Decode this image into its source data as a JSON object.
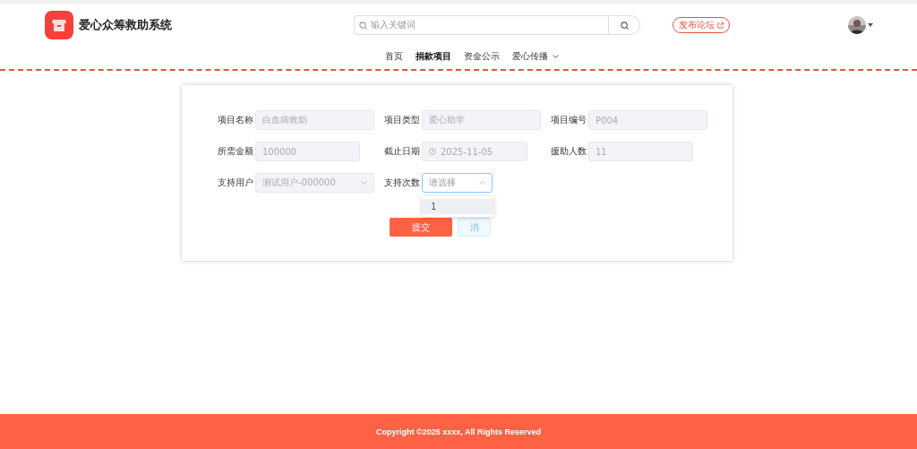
{
  "header": {
    "title": "爱心众筹救助系统",
    "search": {
      "placeholder": "输入关键词"
    },
    "publish_button": "发布论坛"
  },
  "nav": [
    {
      "label": "首页",
      "selected": false,
      "dropdown": false
    },
    {
      "label": "捐款项目",
      "selected": true,
      "dropdown": false
    },
    {
      "label": "资金公示",
      "selected": false,
      "dropdown": false
    },
    {
      "label": "爱心传播",
      "selected": false,
      "dropdown": true
    }
  ],
  "form": {
    "rows": [
      [
        {
          "label": "项目名称",
          "kind": "text",
          "value": "白血病救助",
          "disabled": true
        },
        {
          "label": "项目类型",
          "kind": "text",
          "value": "爱心助学",
          "disabled": true
        },
        {
          "label": "项目编号",
          "kind": "text",
          "value": "P004",
          "disabled": true
        }
      ],
      [
        {
          "label": "所需金额",
          "kind": "text",
          "value": "100000",
          "disabled": true
        },
        {
          "label": "截止日期",
          "kind": "date",
          "value": "2025-11-05",
          "disabled": true
        },
        {
          "label": "援助人数",
          "kind": "text",
          "value": "11",
          "disabled": true
        }
      ],
      [
        {
          "label": "支持用户",
          "kind": "select",
          "value": "测试用户-000000",
          "disabled": true,
          "expanded": false
        },
        {
          "label": "支持次数",
          "kind": "select",
          "placeholder": "请选择",
          "disabled": false,
          "expanded": true,
          "options": [
            {
              "label": "1",
              "highlighted": true
            }
          ]
        }
      ]
    ],
    "buttons": [
      {
        "label": "提交",
        "kind": "primary"
      },
      {
        "label": "消",
        "kind": "plain"
      }
    ]
  },
  "footer": {
    "copyright": "Copyright ©2025 xxxx, All Rights Reserved"
  }
}
